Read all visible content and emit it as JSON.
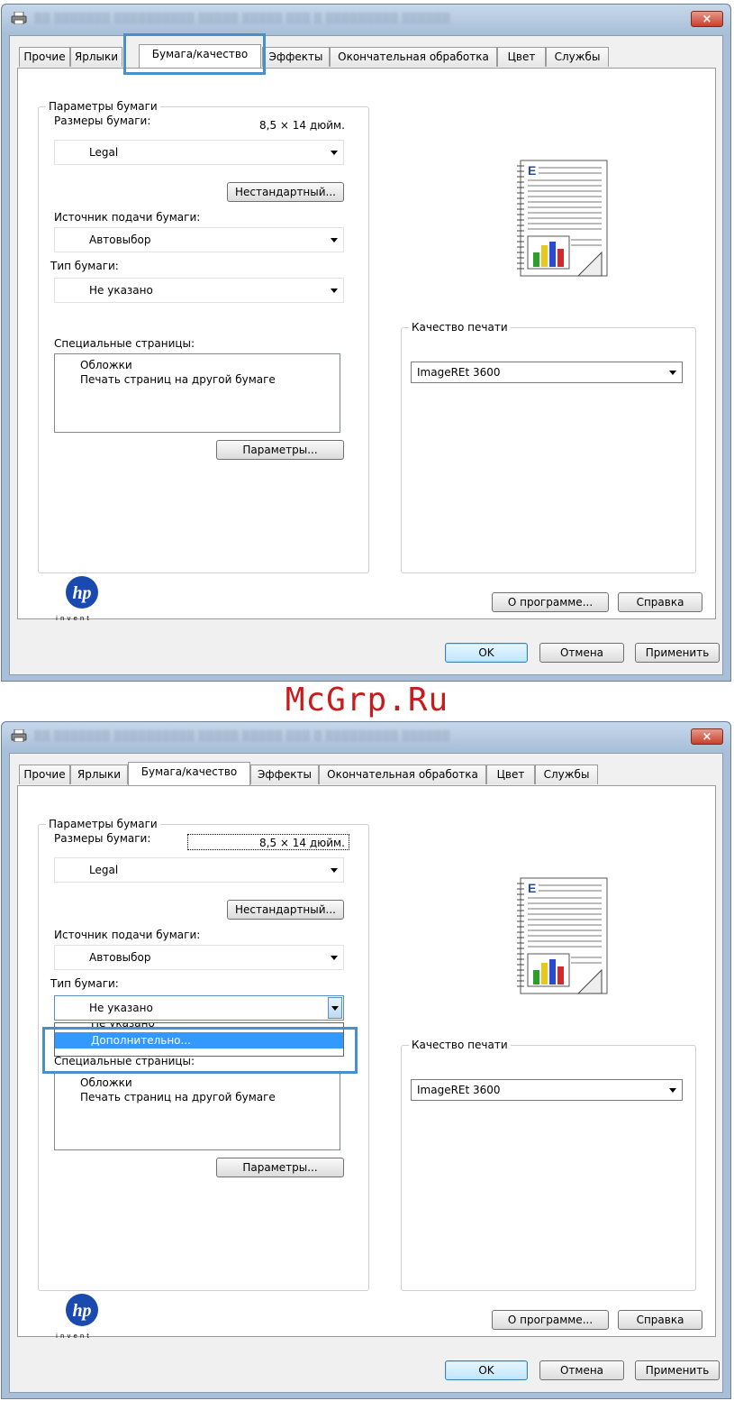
{
  "tabs": [
    "Прочие",
    "Ярлыки",
    "Бумага/качество",
    "Эффекты",
    "Окончательная обработка",
    "Цвет",
    "Службы"
  ],
  "close_symbol": "×",
  "paper_group": {
    "legend": "Параметры бумаги",
    "size_label": "Размеры бумаги:",
    "size_value": "8,5 × 14 дюйм.",
    "size_select": "Legal",
    "custom_button": "Нестандартный...",
    "source_label": "Источник подачи бумаги:",
    "source_select": "Автовыбор",
    "type_label": "Тип бумаги:",
    "type_select": "Не указано",
    "special_label": "Специальные страницы:",
    "special_items": [
      "Обложки",
      "Печать страниц на другой бумаге"
    ],
    "settings_button": "Параметры..."
  },
  "quality_group": {
    "legend": "Качество печати",
    "select": "ImageREt 3600"
  },
  "dropdown": {
    "options": [
      "Не указано",
      "Дополнительно..."
    ],
    "selected_index": 1
  },
  "logo": {
    "text": "invent"
  },
  "buttons": {
    "about": "О программе...",
    "help": "Справка",
    "ok": "OK",
    "cancel": "Отмена",
    "apply": "Применить"
  },
  "watermark": "McGrp.Ru",
  "colors": {
    "highlight": "#4a90c8",
    "selection": "#3399ff",
    "watermark": "#c81c1c"
  }
}
